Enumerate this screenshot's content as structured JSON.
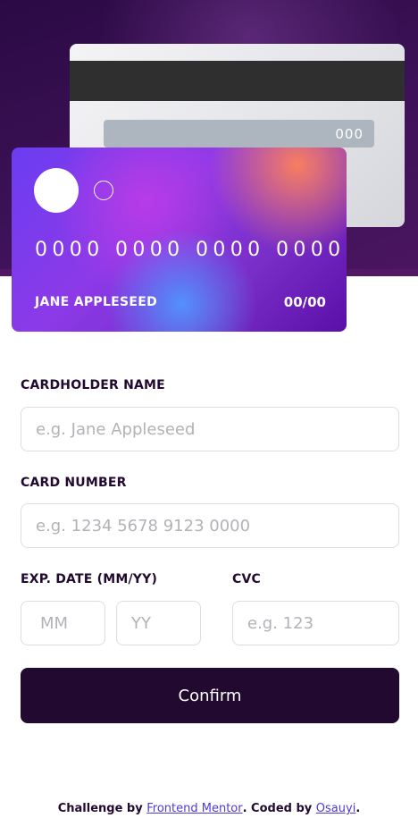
{
  "card_back": {
    "cvc": "000"
  },
  "card_front": {
    "number": "0000 0000 0000 0000",
    "name": "JANE APPLESEED",
    "expiry": "00/00"
  },
  "form": {
    "cardholder_label": "CARDHOLDER NAME",
    "cardholder_placeholder": "e.g. Jane Appleseed",
    "number_label": "CARD NUMBER",
    "number_placeholder": "e.g. 1234 5678 9123 0000",
    "exp_label": "EXP. DATE (MM/YY)",
    "month_placeholder": "MM",
    "year_placeholder": "YY",
    "cvc_label": "CVC",
    "cvc_placeholder": "e.g. 123",
    "confirm_label": "Confirm"
  },
  "footer": {
    "prefix": "Challenge by ",
    "mentor_link": "Frontend Mentor",
    "middle": ". Coded by ",
    "author_link": "Osauyi",
    "suffix": "."
  },
  "colors": {
    "dark_violet": "#21092f",
    "link": "#4f3bd3",
    "border": "#dedddf",
    "placeholder": "#b4b1b7"
  }
}
